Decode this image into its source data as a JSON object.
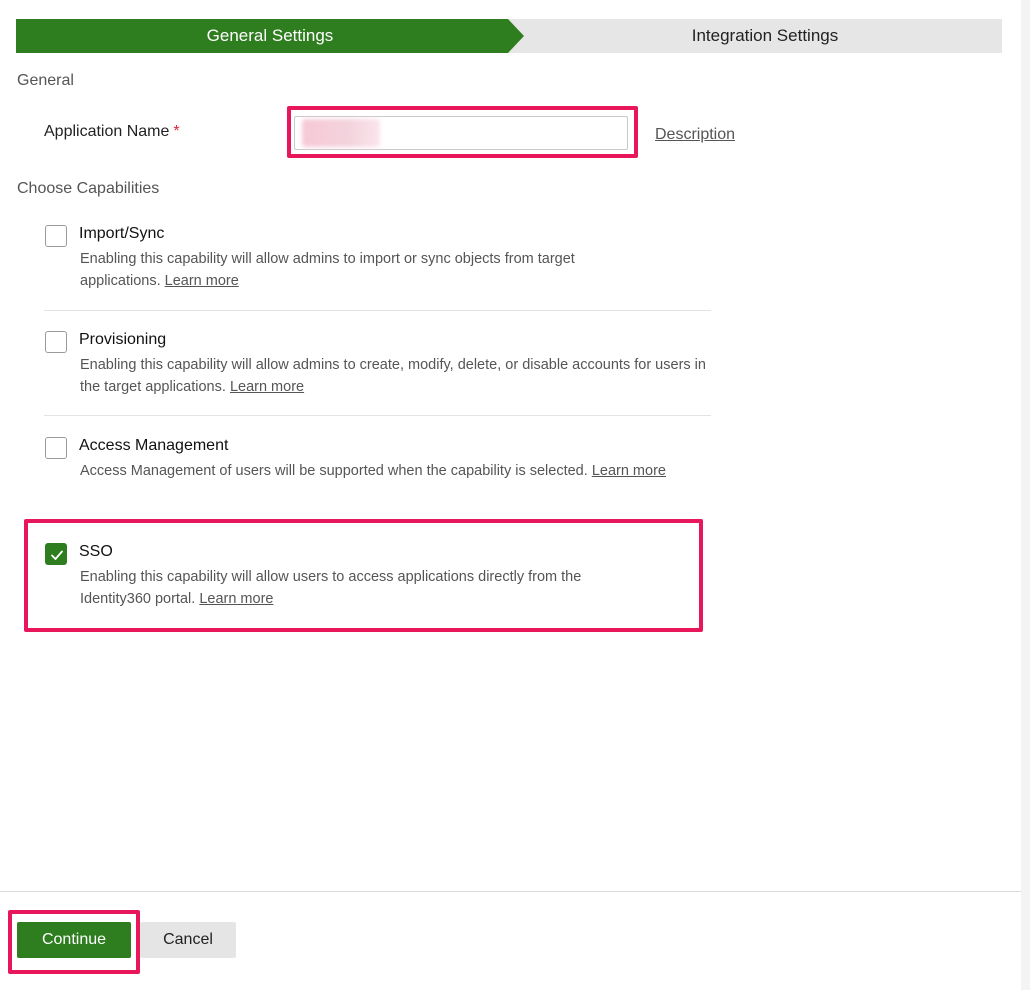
{
  "stepper": {
    "active_step": "General Settings",
    "next_step": "Integration Settings"
  },
  "general": {
    "section_title": "General",
    "app_name_label": "Application Name",
    "required_marker": "*",
    "app_name_value": "",
    "description_link": "Description"
  },
  "capabilities": {
    "section_title": "Choose Capabilities",
    "items": [
      {
        "title": "Import/Sync",
        "description": "Enabling this capability will allow admins to import or sync objects from target applications.",
        "learn_more": "Learn more",
        "checked": false
      },
      {
        "title": "Provisioning",
        "description": "Enabling this capability will allow admins to create, modify, delete, or disable accounts for users in the target applications.",
        "learn_more": "Learn more",
        "checked": false
      },
      {
        "title": "Access Management",
        "description": "Access Management of users will be supported when the capability is selected.",
        "learn_more": "Learn more",
        "checked": false
      },
      {
        "title": "SSO",
        "description": "Enabling this capability will allow users to access applications directly from the Identity360 portal.",
        "learn_more": "Learn more",
        "checked": true
      }
    ]
  },
  "footer": {
    "continue_label": "Continue",
    "cancel_label": "Cancel"
  },
  "colors": {
    "primary_green": "#2e7d1e",
    "highlight_pink": "#e8165a",
    "required_red": "#e0283c"
  }
}
